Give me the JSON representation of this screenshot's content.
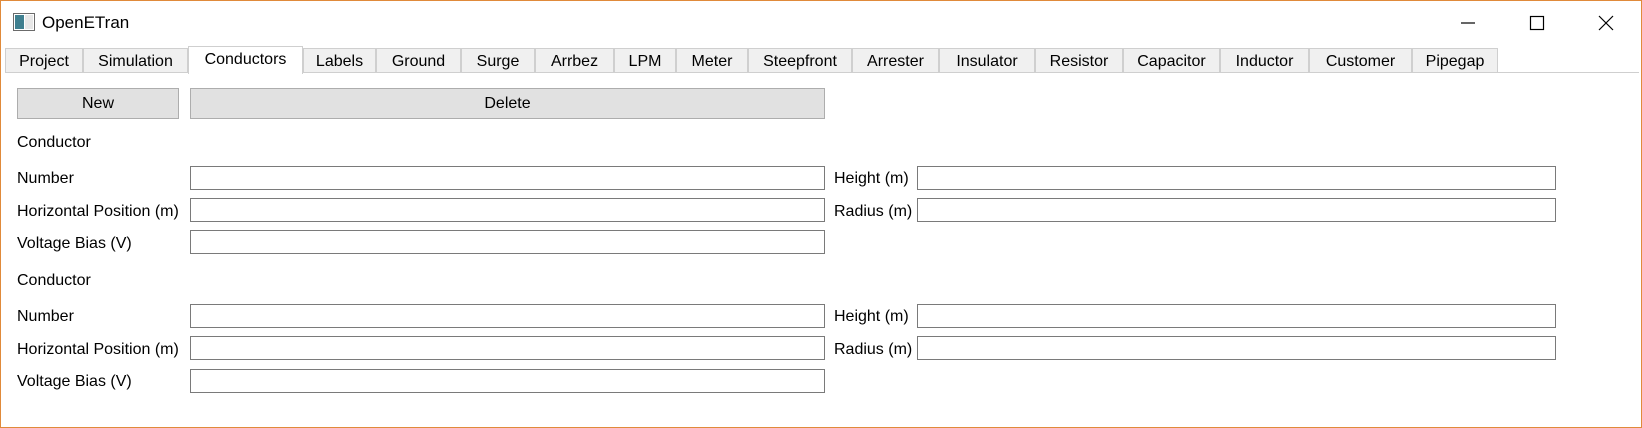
{
  "window": {
    "title": "OpenETran",
    "icons": {
      "app": "app-window-icon",
      "minimize": "minimize-icon",
      "maximize": "maximize-icon",
      "close": "close-icon"
    }
  },
  "tabs": [
    "Project",
    "Simulation",
    "Conductors",
    "Labels",
    "Ground",
    "Surge",
    "Arrbez",
    "LPM",
    "Meter",
    "Steepfront",
    "Arrester",
    "Insulator",
    "Resistor",
    "Capacitor",
    "Inductor",
    "Customer",
    "Pipegap"
  ],
  "active_tab": "Conductors",
  "toolbar": {
    "new_label": "New",
    "delete_label": "Delete"
  },
  "conductors": [
    {
      "header": "Conductor",
      "number_label": "Number",
      "number_value": "",
      "height_label": "Height (m)",
      "height_value": "",
      "hpos_label": "Horizontal Position (m)",
      "hpos_value": "",
      "radius_label": "Radius (m)",
      "radius_value": "",
      "vbias_label": "Voltage Bias (V)",
      "vbias_value": ""
    },
    {
      "header": "Conductor",
      "number_label": "Number",
      "number_value": "",
      "height_label": "Height (m)",
      "height_value": "",
      "hpos_label": "Horizontal Position (m)",
      "hpos_value": "",
      "radius_label": "Radius (m)",
      "radius_value": "",
      "vbias_label": "Voltage Bias (V)",
      "vbias_value": ""
    }
  ]
}
